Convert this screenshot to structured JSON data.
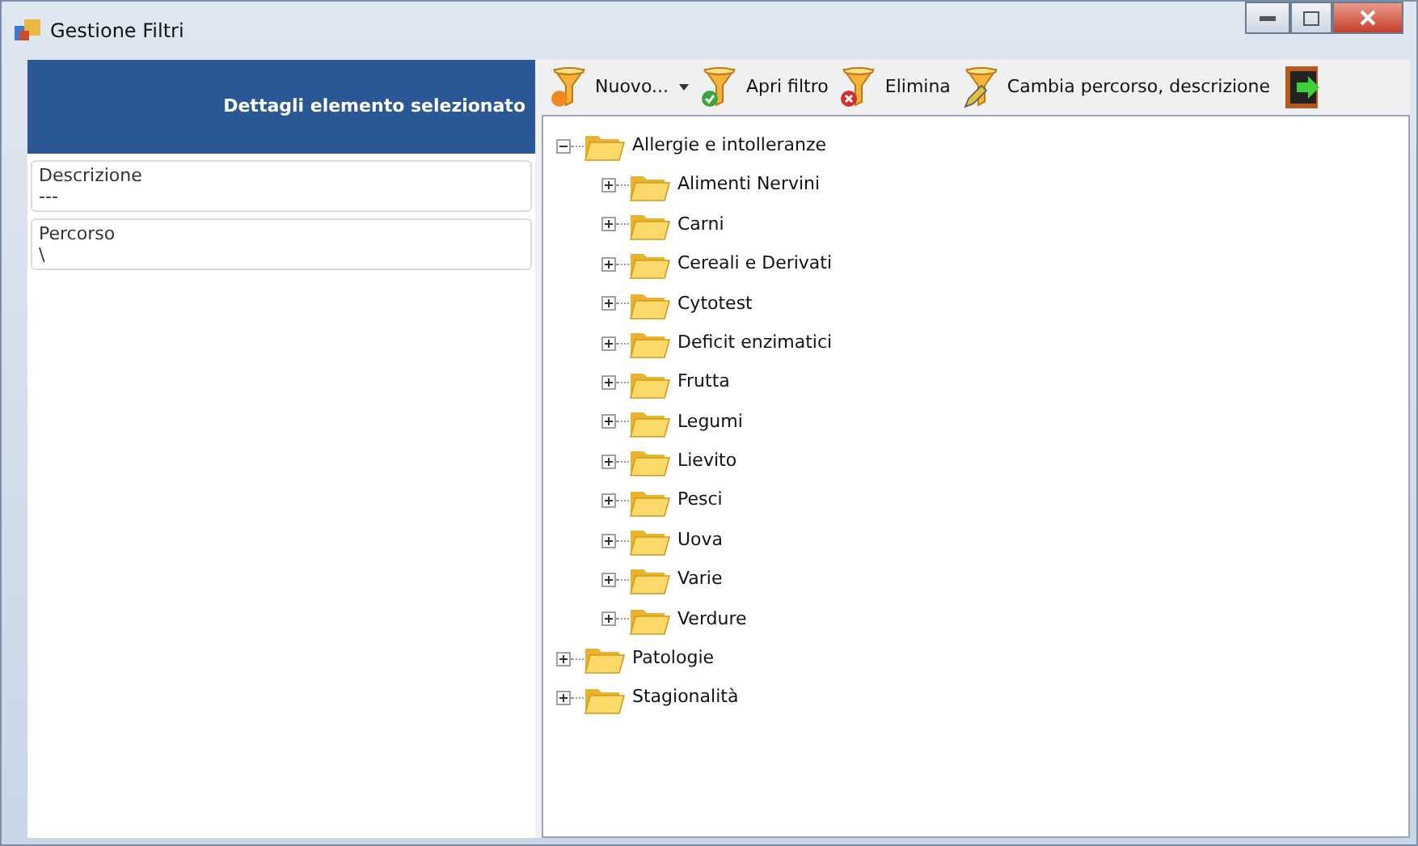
{
  "window": {
    "title": "Gestione Filtri"
  },
  "details": {
    "header": "Dettagli elemento selezionato",
    "fields": [
      {
        "label": "Descrizione",
        "value": "---"
      },
      {
        "label": "Percorso",
        "value": "\\"
      }
    ]
  },
  "toolbar": [
    {
      "label": "Nuovo...",
      "kind": "new",
      "dropdown": true
    },
    {
      "label": "Apri filtro",
      "kind": "open"
    },
    {
      "label": "Elimina",
      "kind": "delete"
    },
    {
      "label": "Cambia percorso, descrizione",
      "kind": "edit"
    },
    {
      "kind": "exit"
    }
  ],
  "tree": [
    {
      "label": "Allergie e intolleranze",
      "expanded": true,
      "children": [
        {
          "label": "Alimenti Nervini",
          "expanded": false
        },
        {
          "label": "Carni",
          "expanded": false
        },
        {
          "label": "Cereali e Derivati",
          "expanded": false
        },
        {
          "label": "Cytotest",
          "expanded": false
        },
        {
          "label": "Deficit enzimatici",
          "expanded": false
        },
        {
          "label": "Frutta",
          "expanded": false
        },
        {
          "label": "Legumi",
          "expanded": false
        },
        {
          "label": "Lievito",
          "expanded": false
        },
        {
          "label": "Pesci",
          "expanded": false
        },
        {
          "label": "Uova",
          "expanded": false
        },
        {
          "label": "Varie",
          "expanded": false
        },
        {
          "label": "Verdure",
          "expanded": false
        }
      ]
    },
    {
      "label": "Patologie",
      "expanded": false
    },
    {
      "label": "Stagionalità",
      "expanded": false
    }
  ]
}
